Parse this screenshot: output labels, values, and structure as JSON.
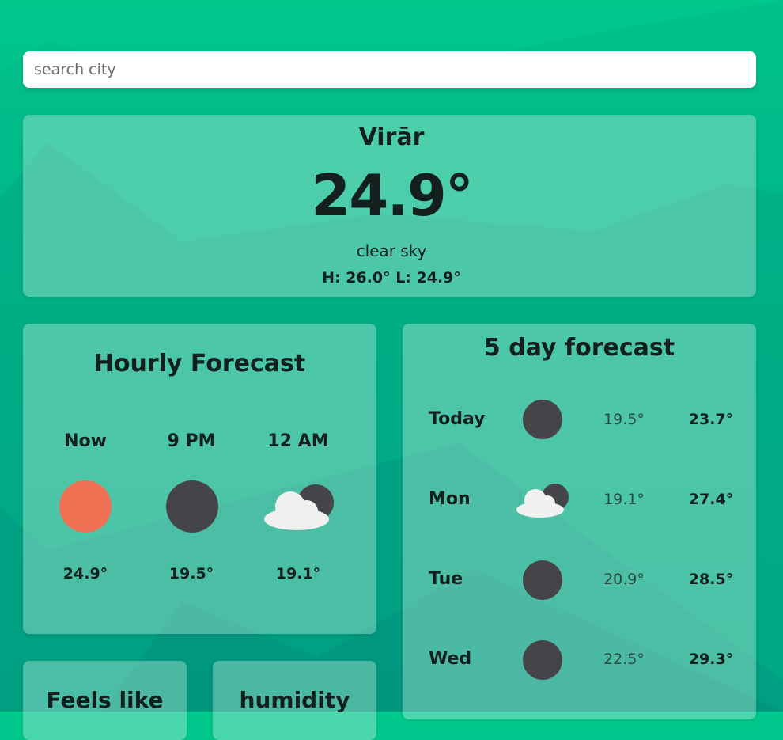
{
  "search": {
    "placeholder": "search city"
  },
  "current": {
    "city": "Virār",
    "temperature": "24.9°",
    "description": "clear sky",
    "high_low": "H: 26.0° L: 24.9°"
  },
  "hourly": {
    "title": "Hourly Forecast",
    "items": [
      {
        "label": "Now",
        "temp": "24.9°",
        "icon": "sun-icon"
      },
      {
        "label": "9 PM",
        "temp": "19.5°",
        "icon": "moon-icon"
      },
      {
        "label": "12 AM",
        "temp": "19.1°",
        "icon": "cloudy-night-icon"
      }
    ]
  },
  "daily": {
    "title": "5 day forecast",
    "items": [
      {
        "day": "Today",
        "low": "19.5°",
        "high": "23.7°",
        "icon": "moon-icon"
      },
      {
        "day": "Mon",
        "low": "19.1°",
        "high": "27.4°",
        "icon": "cloudy-night-icon"
      },
      {
        "day": "Tue",
        "low": "20.9°",
        "high": "28.5°",
        "icon": "moon-icon"
      },
      {
        "day": "Wed",
        "low": "22.5°",
        "high": "29.3°",
        "icon": "moon-icon"
      }
    ]
  },
  "feels_like": {
    "title": "Feels like"
  },
  "humidity": {
    "title": "humidity"
  },
  "colors": {
    "sun": "#ef7052",
    "moon": "#454448",
    "cloud": "#f0f0ee",
    "background_top": "#00c98c",
    "background_bottom": "#008a7a"
  }
}
